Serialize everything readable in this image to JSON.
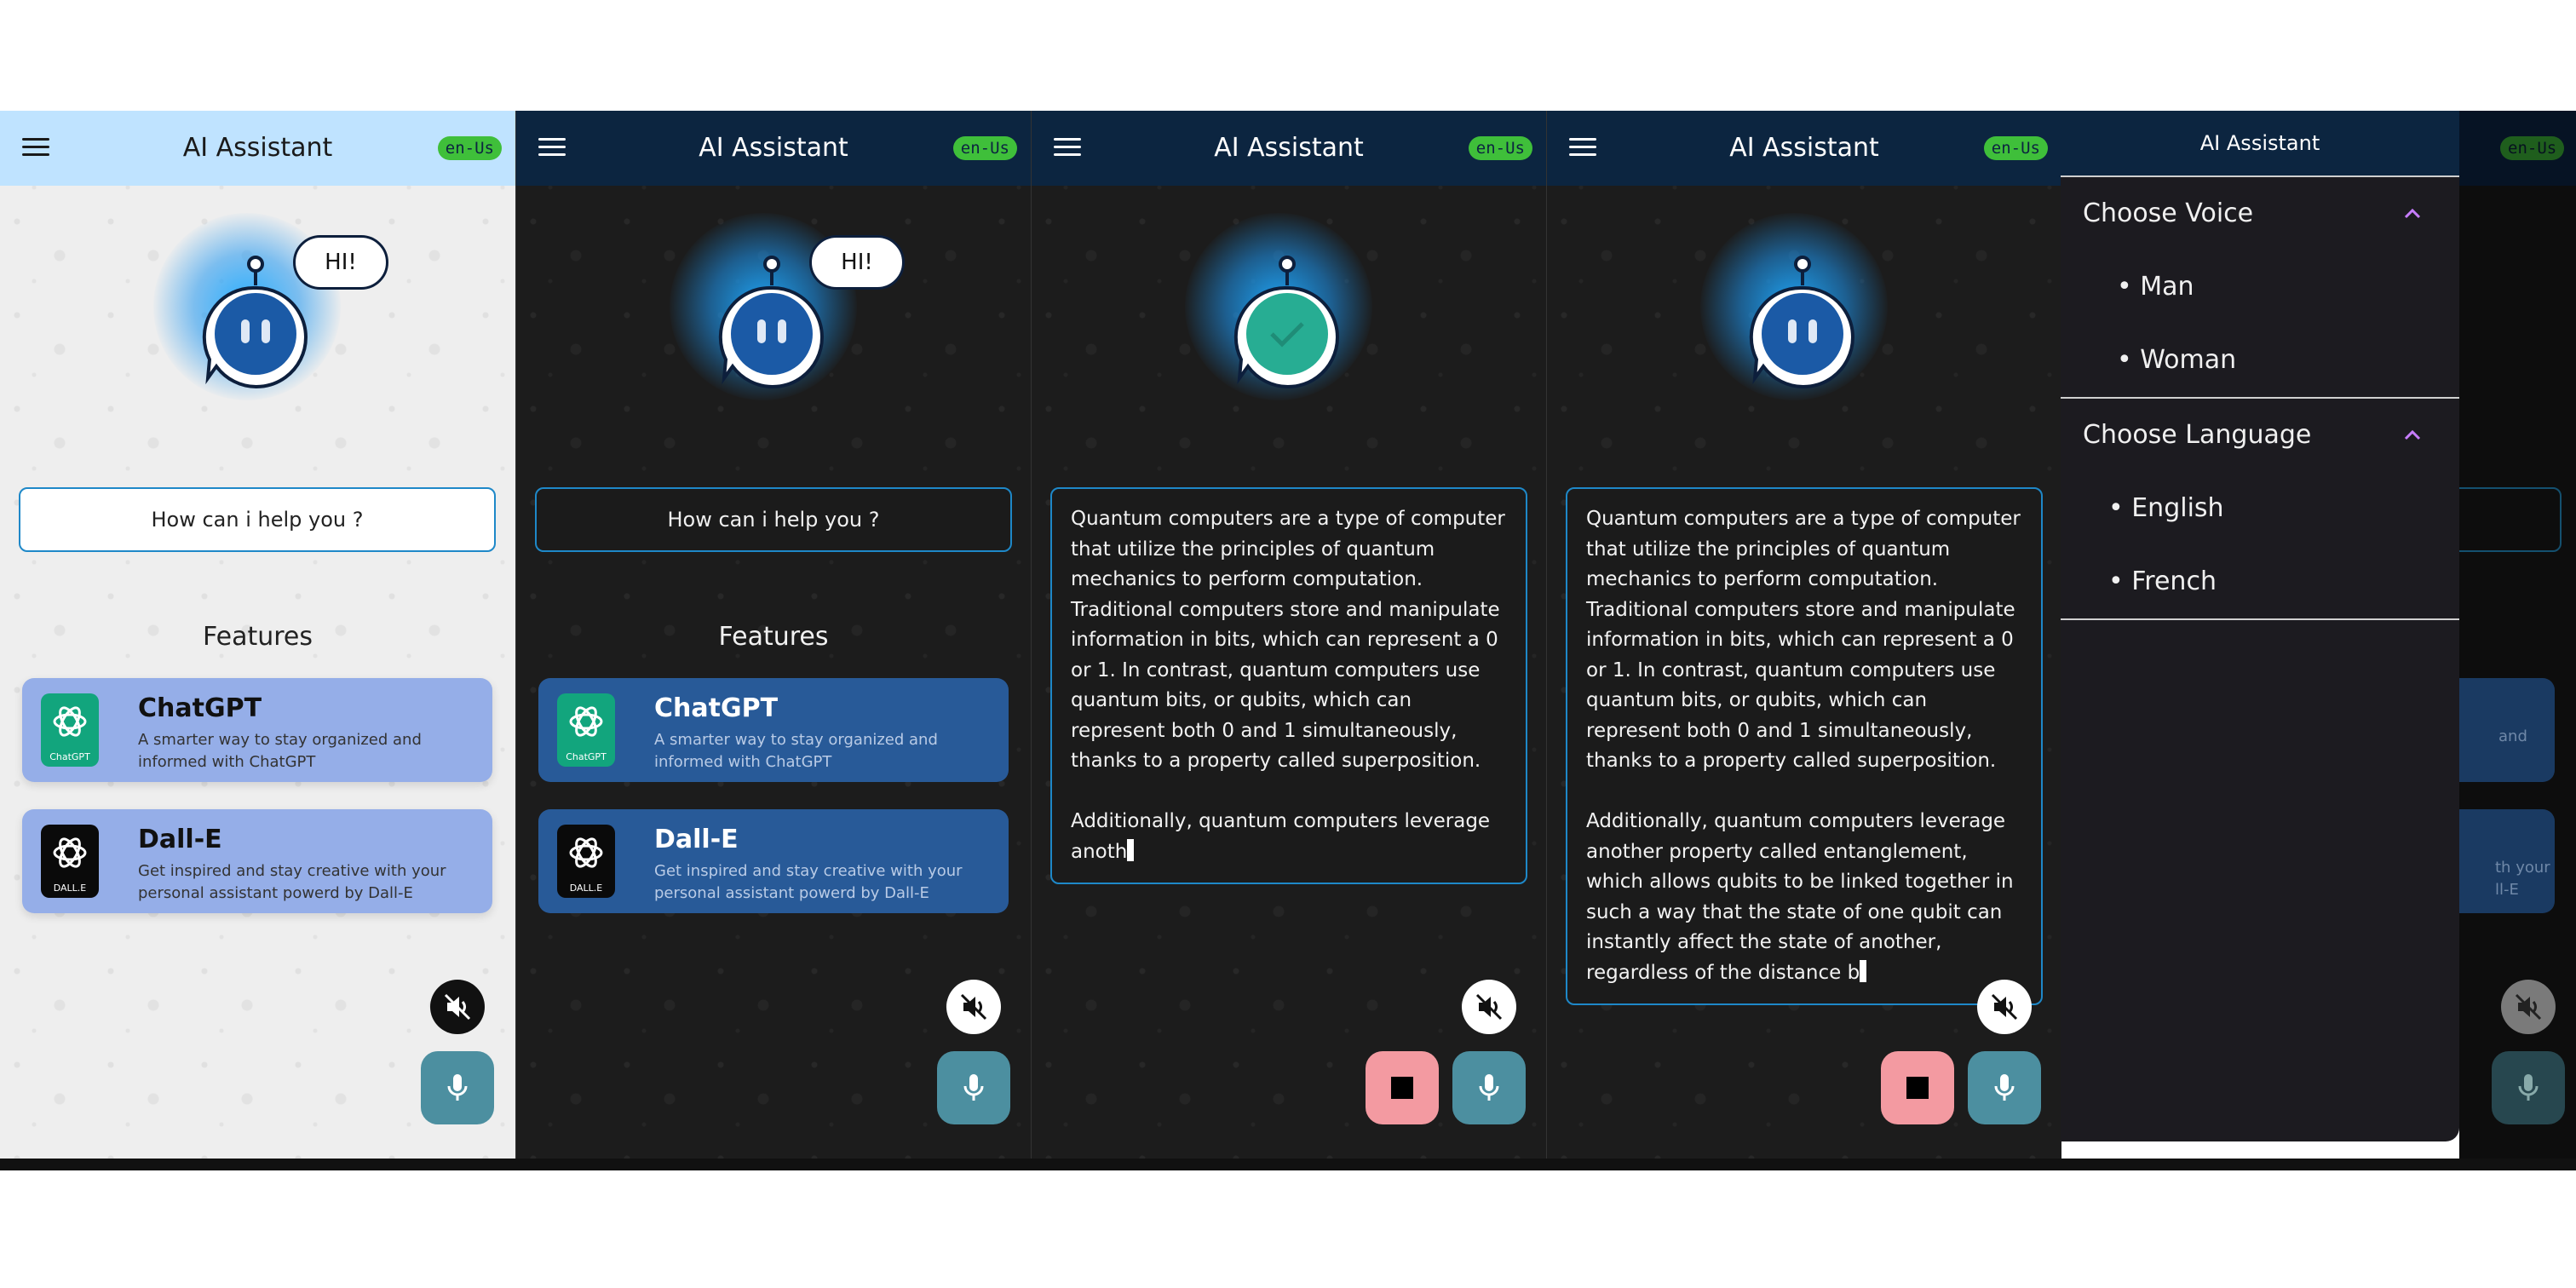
{
  "app": {
    "title": "AI Assistant",
    "lang_chip": "en-Us"
  },
  "colors": {
    "accent": "#1e88c8",
    "chip": "#3fbf3a",
    "chatgpt": "#12a57d",
    "mic": "#4c8fa0",
    "stop": "#f39aa1"
  },
  "home": {
    "bubble": "HI!",
    "prompt": "How can i help you ?",
    "features_title": "Features",
    "features": [
      {
        "name": "ChatGPT",
        "logo_caption": "ChatGPT",
        "description": "A smarter way to stay organized and informed with ChatGPT",
        "icon": "chatgpt-logo-icon"
      },
      {
        "name": "Dall-E",
        "logo_caption": "DALL.E",
        "description": "Get inspired and stay creative with your personal assistant powerd by Dall-E",
        "icon": "dalle-logo-icon"
      }
    ]
  },
  "responses": {
    "panel3": "Quantum computers are a type of computer that utilize the principles of quantum mechanics to perform computation. Traditional computers store and manipulate information in bits, which can represent a 0 or 1. In contrast, quantum computers use quantum bits, or qubits, which can represent both 0 and 1 simultaneously, thanks to a property called superposition.\n\nAdditionally, quantum computers leverage anoth",
    "panel4": "Quantum computers are a type of computer that utilize the principles of quantum mechanics to perform computation. Traditional computers store and manipulate information in bits, which can represent a 0 or 1. In contrast, quantum computers use quantum bits, or qubits, which can represent both 0 and 1 simultaneously, thanks to a property called superposition.\n\nAdditionally, quantum computers leverage another property called entanglement, which allows qubits to be linked together in such a way that the state of one qubit can instantly affect the state of another, regardless of the distance b"
  },
  "drawer": {
    "title": "AI Assistant",
    "voice_heading": "Choose Voice",
    "voices": [
      "• Man",
      "• Woman"
    ],
    "language_heading": "Choose Language",
    "languages": [
      "• English",
      "• French"
    ],
    "ghost_card_text_1": "and",
    "ghost_card_text_2a": "th your",
    "ghost_card_text_2b": "ll-E"
  }
}
